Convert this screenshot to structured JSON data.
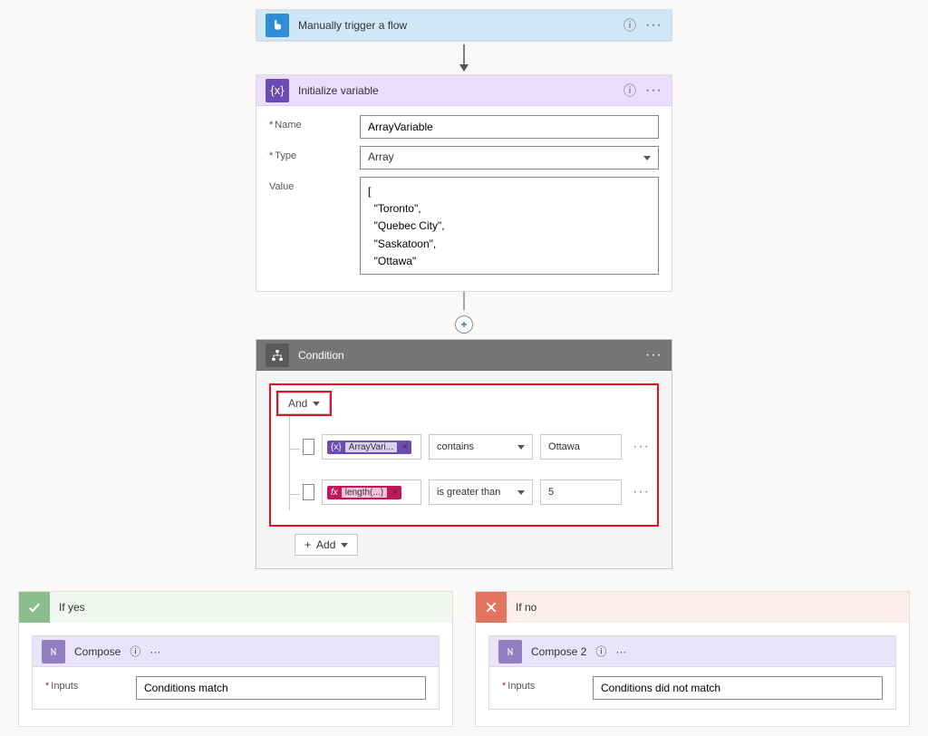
{
  "trigger": {
    "title": "Manually trigger a flow"
  },
  "init_var": {
    "title": "Initialize variable",
    "name_label": "Name",
    "name_value": "ArrayVariable",
    "type_label": "Type",
    "type_value": "Array",
    "value_label": "Value",
    "value_text": "[\n  \"Toronto\",\n  \"Quebec City\",\n  \"Saskatoon\",\n  \"Ottawa\"\n]"
  },
  "condition": {
    "title": "Condition",
    "group_op": "And",
    "rows": [
      {
        "token": "ArrayVari...",
        "token_type": "var",
        "op": "contains",
        "value": "Ottawa"
      },
      {
        "token": "length(...)",
        "token_type": "fx",
        "op": "is greater than",
        "value": "5"
      }
    ],
    "add_label": "Add"
  },
  "branch_yes": {
    "header": "If yes",
    "compose_title": "Compose",
    "inputs_label": "Inputs",
    "inputs_value": "Conditions match"
  },
  "branch_no": {
    "header": "If no",
    "compose_title": "Compose 2",
    "inputs_label": "Inputs",
    "inputs_value": "Conditions did not match"
  }
}
